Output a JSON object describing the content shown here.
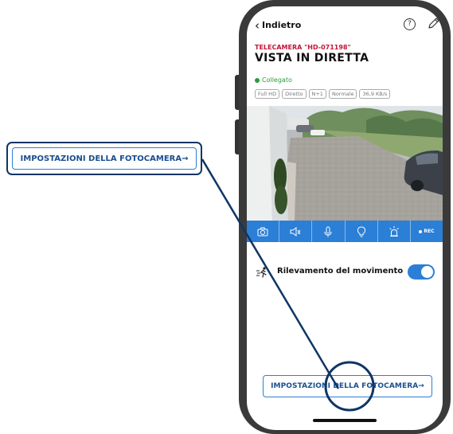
{
  "callout": {
    "label": "IMPOSTAZIONI DELLA FOTOCAMERA→"
  },
  "topbar": {
    "back_label": "Indietro",
    "help_glyph": "?"
  },
  "camera": {
    "id_label": "TELECAMERA \"HD-071198\"",
    "title": "VISTA IN DIRETTA",
    "status": "Collegato",
    "badges": [
      "Full HD",
      "Diretto",
      "N+1",
      "Normale",
      "36,9 KB/s"
    ]
  },
  "controls": {
    "icons": [
      "camera-icon",
      "speaker-icon",
      "microphone-icon",
      "light-bulb-icon",
      "siren-icon"
    ],
    "rec_label": "REC"
  },
  "motion": {
    "label": "Rilevamento del movimento",
    "enabled": true
  },
  "settings_button": {
    "label": "IMPOSTAZIONI DELLA FOTOCAMERA→"
  },
  "colors": {
    "accent": "#2b7fd6",
    "callout_border": "#0f3566",
    "brand_red": "#c4133a",
    "status_green": "#2a9d3a"
  }
}
